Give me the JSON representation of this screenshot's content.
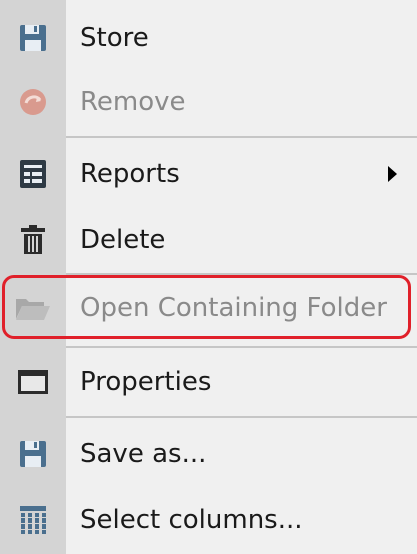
{
  "menu": {
    "items": [
      {
        "label": "Store",
        "icon": "floppy-disk-icon",
        "enabled": true
      },
      {
        "label": "Remove",
        "icon": "remove-circle-icon",
        "enabled": false
      },
      {
        "label": "Reports",
        "icon": "report-icon",
        "enabled": true,
        "has_submenu": true
      },
      {
        "label": "Delete",
        "icon": "trash-icon",
        "enabled": true
      },
      {
        "label": "Open Containing Folder",
        "icon": "folder-open-icon",
        "enabled": false,
        "highlighted": true
      },
      {
        "label": "Properties",
        "icon": "window-icon",
        "enabled": true
      },
      {
        "label": "Save as...",
        "icon": "floppy-disk-icon",
        "enabled": true
      },
      {
        "label": "Select columns...",
        "icon": "columns-icon",
        "enabled": true
      }
    ]
  },
  "colors": {
    "highlight_border": "#e0202a",
    "gutter": "#d4d4d4",
    "menu_background": "#f0f0f0",
    "disabled_text": "#8a8a8a"
  }
}
